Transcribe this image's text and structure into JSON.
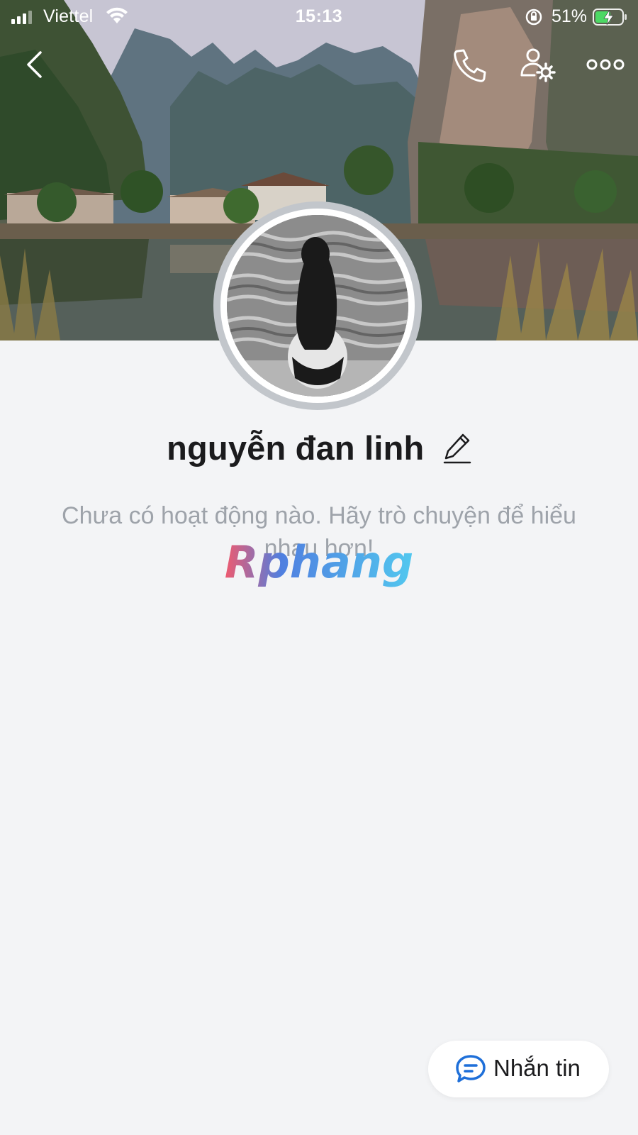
{
  "status_bar": {
    "carrier": "Viettel",
    "time": "15:13",
    "battery_percent": "51%"
  },
  "profile": {
    "name": "nguyễn đan linh",
    "empty_state": "Chưa có hoạt động nào. Hãy trò chuyện để hiểu nhau hơn!"
  },
  "watermark": "Rphang",
  "actions": {
    "message_label": "Nhắn tin"
  },
  "colors": {
    "background": "#f3f4f6",
    "accent_blue": "#1e6fd9",
    "text_primary": "#1b1b1d",
    "text_muted": "#9ea3aa"
  },
  "icons": [
    "back-icon",
    "phone-icon",
    "user-settings-icon",
    "more-icon",
    "edit-pencil-icon",
    "chat-bubble-icon"
  ]
}
